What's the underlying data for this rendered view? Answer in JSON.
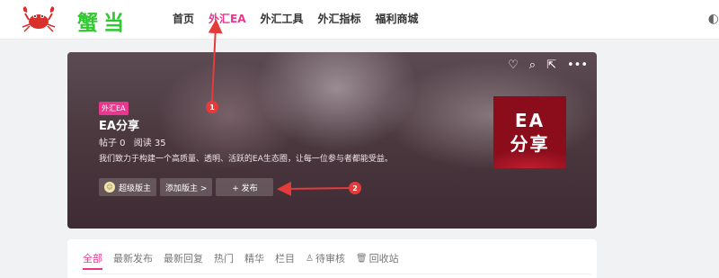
{
  "header": {
    "logo_text": "蟹当",
    "nav": [
      "首页",
      "外汇EA",
      "外汇工具",
      "外汇指标",
      "福利商城"
    ],
    "active_nav": 1
  },
  "banner": {
    "tag": "外汇EA",
    "title": "EA分享",
    "stats": {
      "posts": "帖子 0",
      "reads": "阅读 35"
    },
    "description": "我们致力于构建一个高质量、透明、活跃的EA生态圈，让每一位参与者都能受益。",
    "buttons": {
      "super_moderator": "超级版主",
      "add_moderator": "添加版主 >",
      "publish": "+ 发布"
    },
    "thumbnail": {
      "line1": "EA",
      "line2": "分享"
    },
    "actions": [
      "heart-icon",
      "search-icon",
      "share-icon",
      "more-icon"
    ]
  },
  "annotations": {
    "marker1": "1",
    "marker2": "2"
  },
  "tabs": [
    "全部",
    "最新发布",
    "最新回复",
    "热门",
    "精华",
    "栏目",
    "待审核",
    "回收站"
  ],
  "colors": {
    "accent": "#e8378f",
    "logo": "#2fc92f",
    "annotation": "#e53b3b"
  }
}
